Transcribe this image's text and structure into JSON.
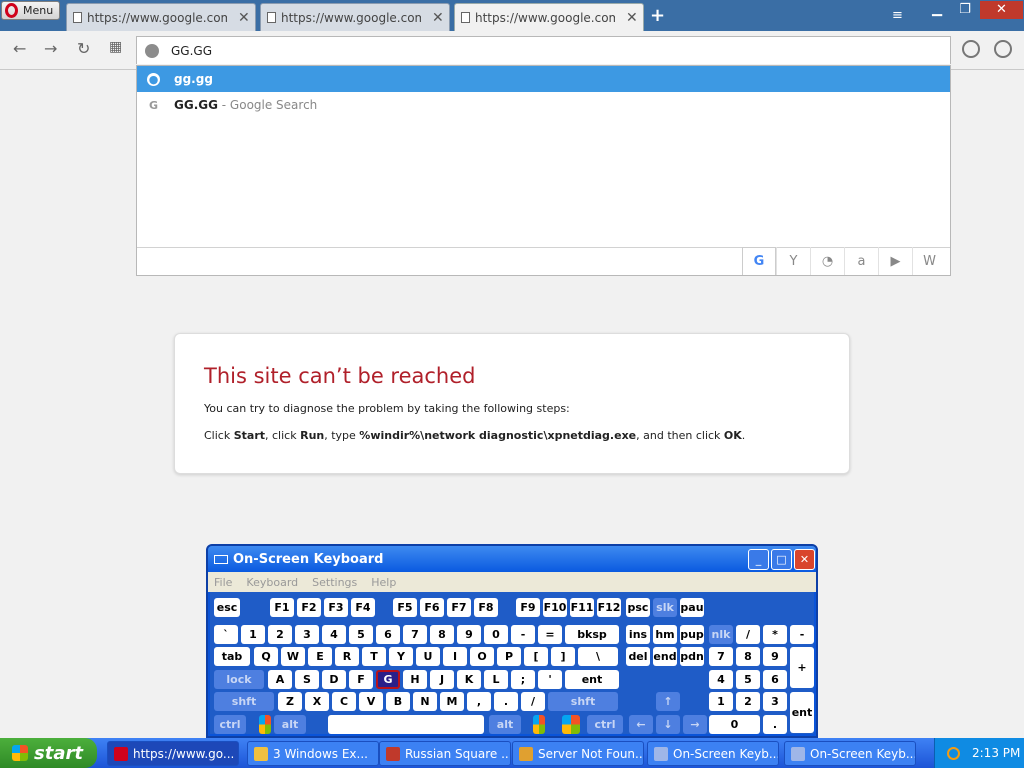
{
  "browser": {
    "menu_label": "Menu",
    "tabs": [
      {
        "title": "https://www.google.com/search"
      },
      {
        "title": "https://www.google.com/search"
      },
      {
        "title": "https://www.google.com/search"
      }
    ],
    "address_text": "GG.GG",
    "suggestions": [
      {
        "main": "gg.gg",
        "sub": "",
        "icon": "globe-icon"
      },
      {
        "main": "GG.GG",
        "sub": " - Google Search",
        "icon": "google-icon"
      }
    ],
    "search_engines": [
      "google-icon",
      "yahoo-icon",
      "duckduckgo-icon",
      "amazon-icon",
      "bing-icon",
      "wikipedia-icon"
    ]
  },
  "error": {
    "title": "This site can’t be reached",
    "line1": "You can try to diagnose the problem by taking the following steps:",
    "line2_prefix": "Click ",
    "start": "Start",
    "sep1": ", click ",
    "run": "Run",
    "sep2": ", type ",
    "command": "%windir%\\network diagnostic\\xpnetdiag.exe",
    "sep3": ", and then click ",
    "ok": "OK",
    "end": "."
  },
  "osk": {
    "title": "On-Screen Keyboard",
    "menus": [
      "File",
      "Keyboard",
      "Settings",
      "Help"
    ],
    "rows": [
      [
        "esc",
        "F1",
        "F2",
        "F3",
        "F4",
        "F5",
        "F6",
        "F7",
        "F8",
        "F9",
        "F10",
        "F11",
        "F12",
        "psc",
        "slk",
        "pau"
      ],
      [
        "`",
        "1",
        "2",
        "3",
        "4",
        "5",
        "6",
        "7",
        "8",
        "9",
        "0",
        "-",
        "=",
        "bksp",
        "ins",
        "hm",
        "pup",
        "nlk",
        "/",
        "*",
        "-"
      ],
      [
        "tab",
        "Q",
        "W",
        "E",
        "R",
        "T",
        "Y",
        "U",
        "I",
        "O",
        "P",
        "[",
        "]",
        "\\",
        "del",
        "end",
        "pdn",
        "7",
        "8",
        "9",
        "+"
      ],
      [
        "lock",
        "A",
        "S",
        "D",
        "F",
        "G",
        "H",
        "J",
        "K",
        "L",
        ";",
        "'",
        "ent",
        "4",
        "5",
        "6"
      ],
      [
        "shft",
        "Z",
        "X",
        "C",
        "V",
        "B",
        "N",
        "M",
        ",",
        ".",
        "/",
        "shft",
        "1",
        "2",
        "3",
        "ent"
      ],
      [
        "ctrl",
        "alt",
        "alt",
        "ctrl",
        "0",
        "."
      ]
    ],
    "pressed_key": "G"
  },
  "taskbar": {
    "start_label": "start",
    "tasks": [
      {
        "label": "https://www.go...",
        "icon_color": "#d0021b"
      },
      {
        "label": "3 Windows Ex...",
        "icon_color": "#f0c040"
      },
      {
        "label": "Russian Square ...",
        "icon_color": "#c0392b"
      },
      {
        "label": "Server Not Foun...",
        "icon_color": "#e0a030"
      },
      {
        "label": "On-Screen Keyb...",
        "icon_color": "#9fb6e8"
      },
      {
        "label": "On-Screen Keyb...",
        "icon_color": "#9fb6e8"
      }
    ],
    "clock": "2:13 PM"
  }
}
